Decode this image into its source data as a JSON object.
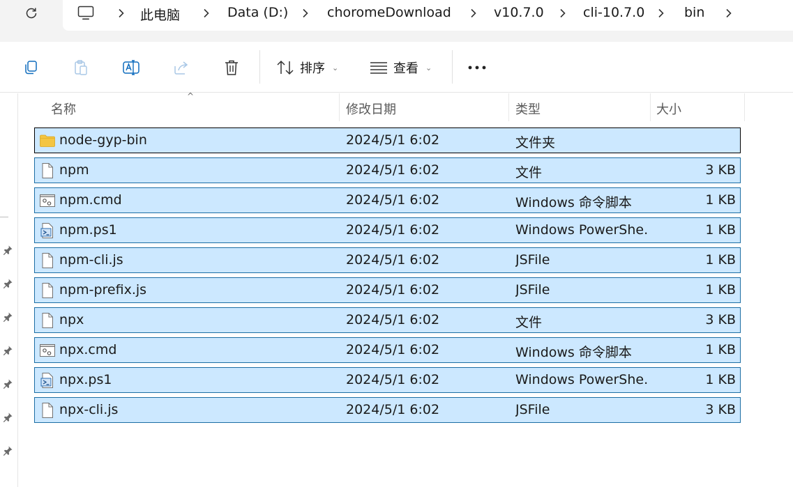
{
  "breadcrumb": {
    "items": [
      "此电脑",
      "Data (D:)",
      "choromeDownload",
      "v10.7.0",
      "cli-10.7.0",
      "bin"
    ]
  },
  "toolbar": {
    "sort_label": "排序",
    "view_label": "查看",
    "more_label": "..."
  },
  "columns": {
    "name": "名称",
    "date": "修改日期",
    "type": "类型",
    "size": "大小"
  },
  "files": [
    {
      "name": "node-gyp-bin",
      "date": "2024/5/1 6:02",
      "type": "文件夹",
      "size": "",
      "icon": "folder-icon"
    },
    {
      "name": "npm",
      "date": "2024/5/1 6:02",
      "type": "文件",
      "size": "3 KB",
      "icon": "file-icon"
    },
    {
      "name": "npm.cmd",
      "date": "2024/5/1 6:02",
      "type": "Windows 命令脚本",
      "size": "1 KB",
      "icon": "cmd-script-icon"
    },
    {
      "name": "npm.ps1",
      "date": "2024/5/1 6:02",
      "type": "Windows PowerShe...",
      "size": "1 KB",
      "icon": "powershell-script-icon"
    },
    {
      "name": "npm-cli.js",
      "date": "2024/5/1 6:02",
      "type": "JSFile",
      "size": "1 KB",
      "icon": "file-icon"
    },
    {
      "name": "npm-prefix.js",
      "date": "2024/5/1 6:02",
      "type": "JSFile",
      "size": "1 KB",
      "icon": "file-icon"
    },
    {
      "name": "npx",
      "date": "2024/5/1 6:02",
      "type": "文件",
      "size": "3 KB",
      "icon": "file-icon"
    },
    {
      "name": "npx.cmd",
      "date": "2024/5/1 6:02",
      "type": "Windows 命令脚本",
      "size": "1 KB",
      "icon": "cmd-script-icon"
    },
    {
      "name": "npx.ps1",
      "date": "2024/5/1 6:02",
      "type": "Windows PowerShe...",
      "size": "1 KB",
      "icon": "powershell-script-icon"
    },
    {
      "name": "npx-cli.js",
      "date": "2024/5/1 6:02",
      "type": "JSFile",
      "size": "3 KB",
      "icon": "file-icon"
    }
  ],
  "colors": {
    "selection_fill": "#cce8ff",
    "selection_border": "#1c6ea4",
    "folder": "#f4c542"
  }
}
